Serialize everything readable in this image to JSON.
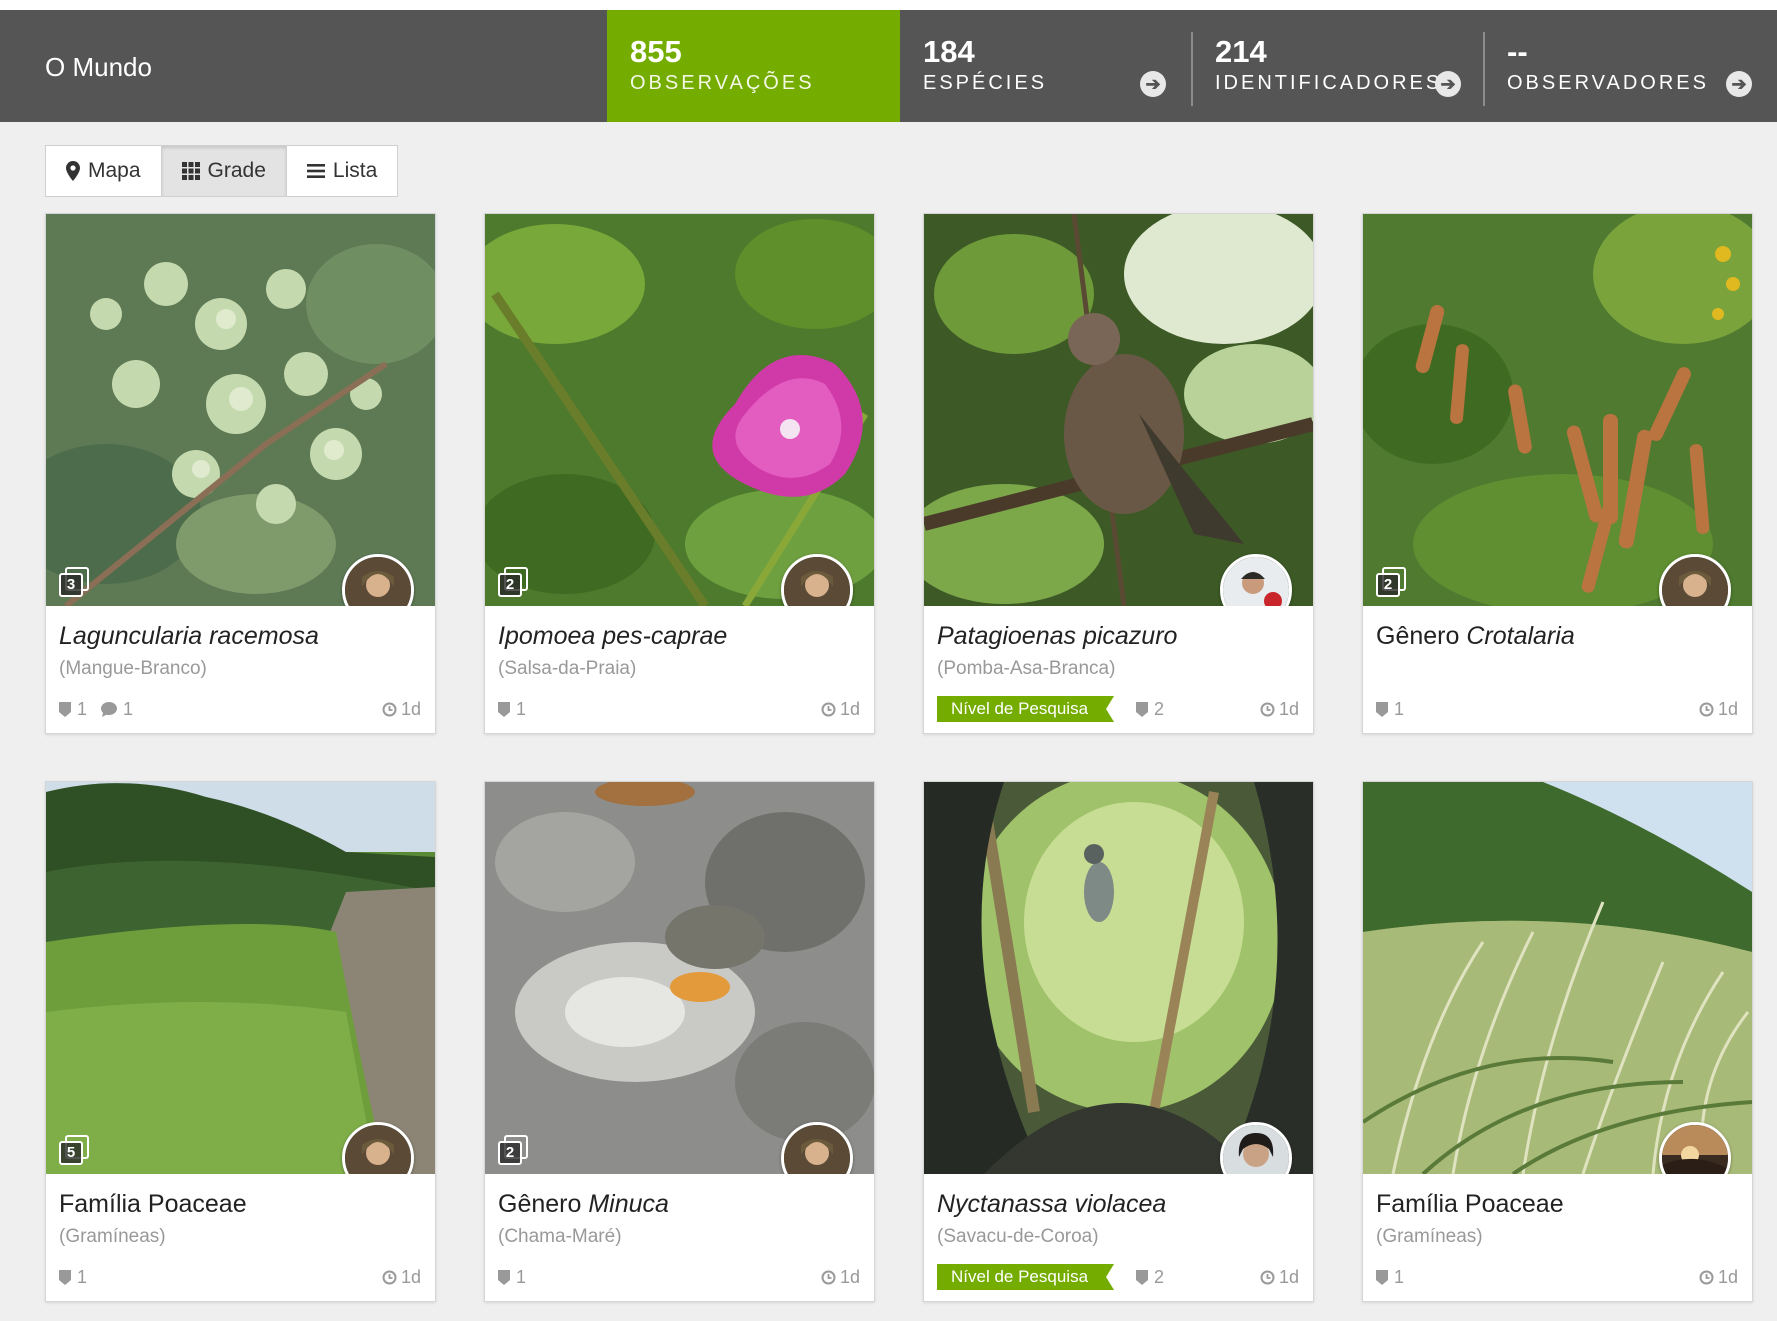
{
  "place": {
    "title": "O Mundo"
  },
  "stats": {
    "observations": {
      "value": "855",
      "label": "OBSERVAÇÕES"
    },
    "species": {
      "value": "184",
      "label": "ESPÉCIES"
    },
    "identifiers": {
      "value": "214",
      "label": "IDENTIFICADORES"
    },
    "observers": {
      "value": "--",
      "label": "OBSERVADORES"
    }
  },
  "view_toggle": {
    "map": "Mapa",
    "grid": "Grade",
    "list": "Lista",
    "active": "grid"
  },
  "colors": {
    "accent": "#74ac00",
    "bar": "#555555",
    "background": "#efefef"
  },
  "cards": [
    {
      "rank": "",
      "taxon": "Laguncularia racemosa",
      "common": "(Mangue-Branco)",
      "photos": "3",
      "ids": "1",
      "comments": "1",
      "quality": "",
      "age": "1d"
    },
    {
      "rank": "",
      "taxon": "Ipomoea pes-caprae",
      "common": "(Salsa-da-Praia)",
      "photos": "2",
      "ids": "1",
      "comments": "",
      "quality": "",
      "age": "1d"
    },
    {
      "rank": "",
      "taxon": "Patagioenas picazuro",
      "common": "(Pomba-Asa-Branca)",
      "photos": "",
      "ids": "2",
      "comments": "",
      "quality": "Nível de Pesquisa",
      "age": "1d"
    },
    {
      "rank": "Gênero ",
      "taxon": "Crotalaria",
      "common": "",
      "photos": "2",
      "ids": "1",
      "comments": "",
      "quality": "",
      "age": "1d"
    },
    {
      "rank": "Família Poaceae",
      "taxon": "",
      "common": "(Gramíneas)",
      "photos": "5",
      "ids": "1",
      "comments": "",
      "quality": "",
      "age": "1d"
    },
    {
      "rank": "Gênero ",
      "taxon": "Minuca",
      "common": "(Chama-Maré)",
      "photos": "2",
      "ids": "1",
      "comments": "",
      "quality": "",
      "age": "1d"
    },
    {
      "rank": "",
      "taxon": "Nyctanassa violacea",
      "common": "(Savacu-de-Coroa)",
      "photos": "",
      "ids": "2",
      "comments": "",
      "quality": "Nível de Pesquisa",
      "age": "1d"
    },
    {
      "rank": "Família Poaceae",
      "taxon": "",
      "common": "(Gramíneas)",
      "photos": "",
      "ids": "1",
      "comments": "",
      "quality": "",
      "age": "1d"
    }
  ]
}
